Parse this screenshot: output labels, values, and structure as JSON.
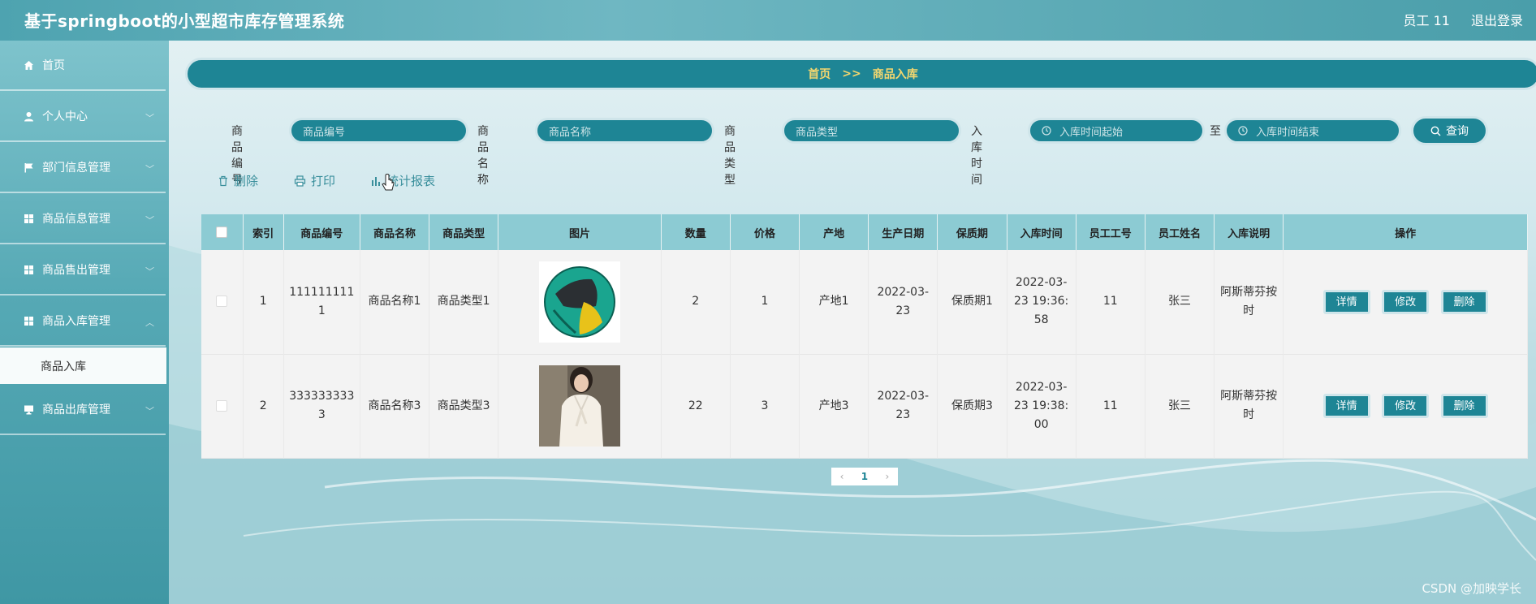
{
  "header": {
    "title": "基于springboot的小型超市库存管理系统",
    "user_label": "员工 11",
    "logout_label": "退出登录"
  },
  "sidebar": {
    "items": [
      {
        "label": "首页",
        "icon": "home-icon"
      },
      {
        "label": "个人中心",
        "icon": "user-icon"
      },
      {
        "label": "部门信息管理",
        "icon": "flag-icon"
      },
      {
        "label": "商品信息管理",
        "icon": "grid-icon"
      },
      {
        "label": "商品售出管理",
        "icon": "grid-icon"
      },
      {
        "label": "商品入库管理",
        "icon": "grid-icon"
      },
      {
        "label": "商品出库管理",
        "icon": "monitor-icon"
      }
    ],
    "active_subitem": "商品入库"
  },
  "breadcrumb": {
    "home": "首页",
    "separator": ">>",
    "current": "商品入库"
  },
  "search": {
    "labels": [
      "商品编号",
      "商品名称",
      "商品类型",
      "入库时间"
    ],
    "placeholders": [
      "商品编号",
      "商品名称",
      "商品类型"
    ],
    "date_from_placeholder": "入库时间起始",
    "date_to_label": "至",
    "date_to_placeholder": "入库时间结束",
    "query_label": "查询"
  },
  "toolbar": {
    "delete_label": "删除",
    "print_label": "打印",
    "report_label": "统计报表"
  },
  "table": {
    "headers": [
      "索引",
      "商品编号",
      "商品名称",
      "商品类型",
      "图片",
      "数量",
      "价格",
      "产地",
      "生产日期",
      "保质期",
      "入库时间",
      "员工工号",
      "员工姓名",
      "入库说明",
      "操作"
    ],
    "rows": [
      {
        "index": "1",
        "code": "1111111111",
        "name": "商品名称1",
        "type": "商品类型1",
        "image": "soccer-ball-image",
        "quantity": "2",
        "price": "1",
        "origin": "产地1",
        "production_date": "2022-03-23",
        "shelf_life": "保质期1",
        "stock_in_time": "2022-03-23 19:36:58",
        "employee_no": "11",
        "employee_name": "张三",
        "note": "阿斯蒂芬按时"
      },
      {
        "index": "2",
        "code": "3333333333",
        "name": "商品名称3",
        "type": "商品类型3",
        "image": "white-blouse-image",
        "quantity": "22",
        "price": "3",
        "origin": "产地3",
        "production_date": "2022-03-23",
        "shelf_life": "保质期3",
        "stock_in_time": "2022-03-23 19:38:00",
        "employee_no": "11",
        "employee_name": "张三",
        "note": "阿斯蒂芬按时"
      }
    ],
    "ops": {
      "detail": "详情",
      "edit": "修改",
      "delete": "删除"
    }
  },
  "pagination": {
    "prev": "‹",
    "current": "1",
    "next": "›"
  },
  "watermark": "CSDN @加映学长",
  "colors": {
    "primary": "#1e8595",
    "accent": "#f5d76e",
    "header_row": "#8ccbd3"
  }
}
